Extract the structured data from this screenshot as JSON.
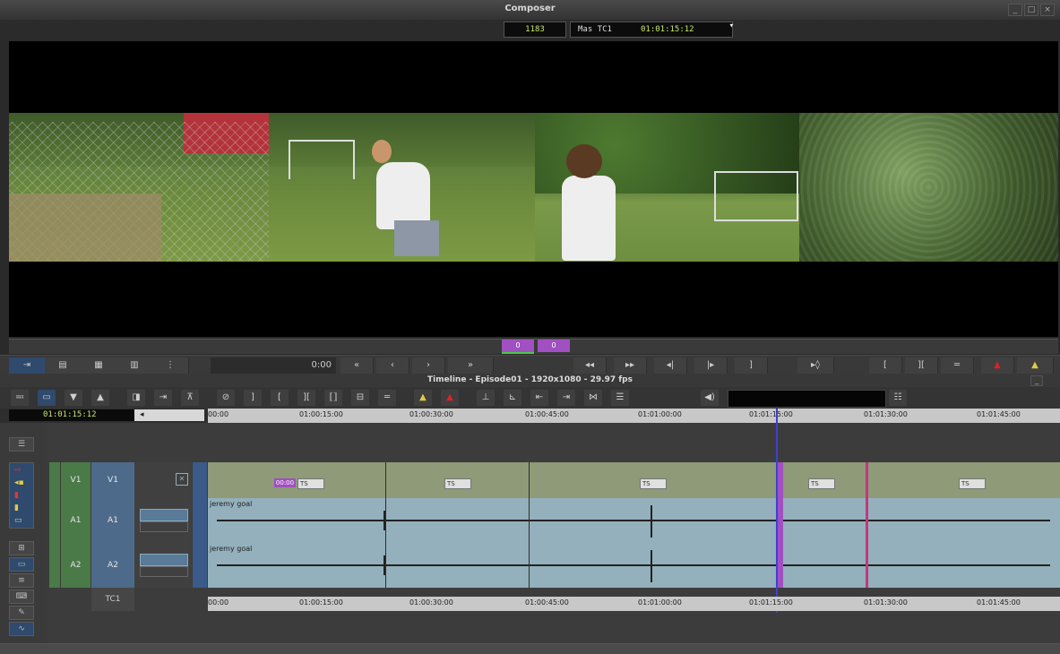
{
  "window": {
    "title": "Composer",
    "controls": [
      "_",
      "□",
      "×"
    ]
  },
  "tc_bar": {
    "frame_count": "1183",
    "mas_label": "Mas TC1",
    "mas_value": "01:01:15:12"
  },
  "scrub": {
    "marker_a": "0",
    "marker_b": "0"
  },
  "transport": {
    "time": "0:00",
    "buttons": [
      "«",
      "‹",
      "›",
      "»",
      "◂◂",
      "▸▸",
      "◂|",
      "|▸",
      "]",
      "▸◊",
      "[",
      "][",
      "═"
    ]
  },
  "timeline": {
    "title": "Timeline - Episode01 - 1920x1080 - 29.97 fps",
    "current_tc": "01:01:15:12",
    "ruler_ticks": [
      "00:00",
      "01:00:15:00",
      "01:00:30:00",
      "01:00:45:00",
      "01:01:00:00",
      "01:01:15:00",
      "01:01:30:00",
      "01:01:45:00"
    ],
    "tracks": [
      {
        "src": "V1",
        "rec": "V1"
      },
      {
        "src": "A1",
        "rec": "A1"
      },
      {
        "src": "A2",
        "rec": "A2"
      },
      {
        "src": "",
        "rec": "TC1"
      }
    ],
    "video_clip_badges": [
      "TS",
      "TS",
      "TS",
      "TS",
      "TS"
    ],
    "first_clip_tag": "00:00",
    "audio_clip_name": "jeremy goal"
  },
  "colors": {
    "accent": "#a050c0",
    "playhead": "#4040d0",
    "v_track": "#8e9a78",
    "a_track": "#94b0bc",
    "src_track": "#4a7a48",
    "rec_track": "#4d6a8a"
  }
}
